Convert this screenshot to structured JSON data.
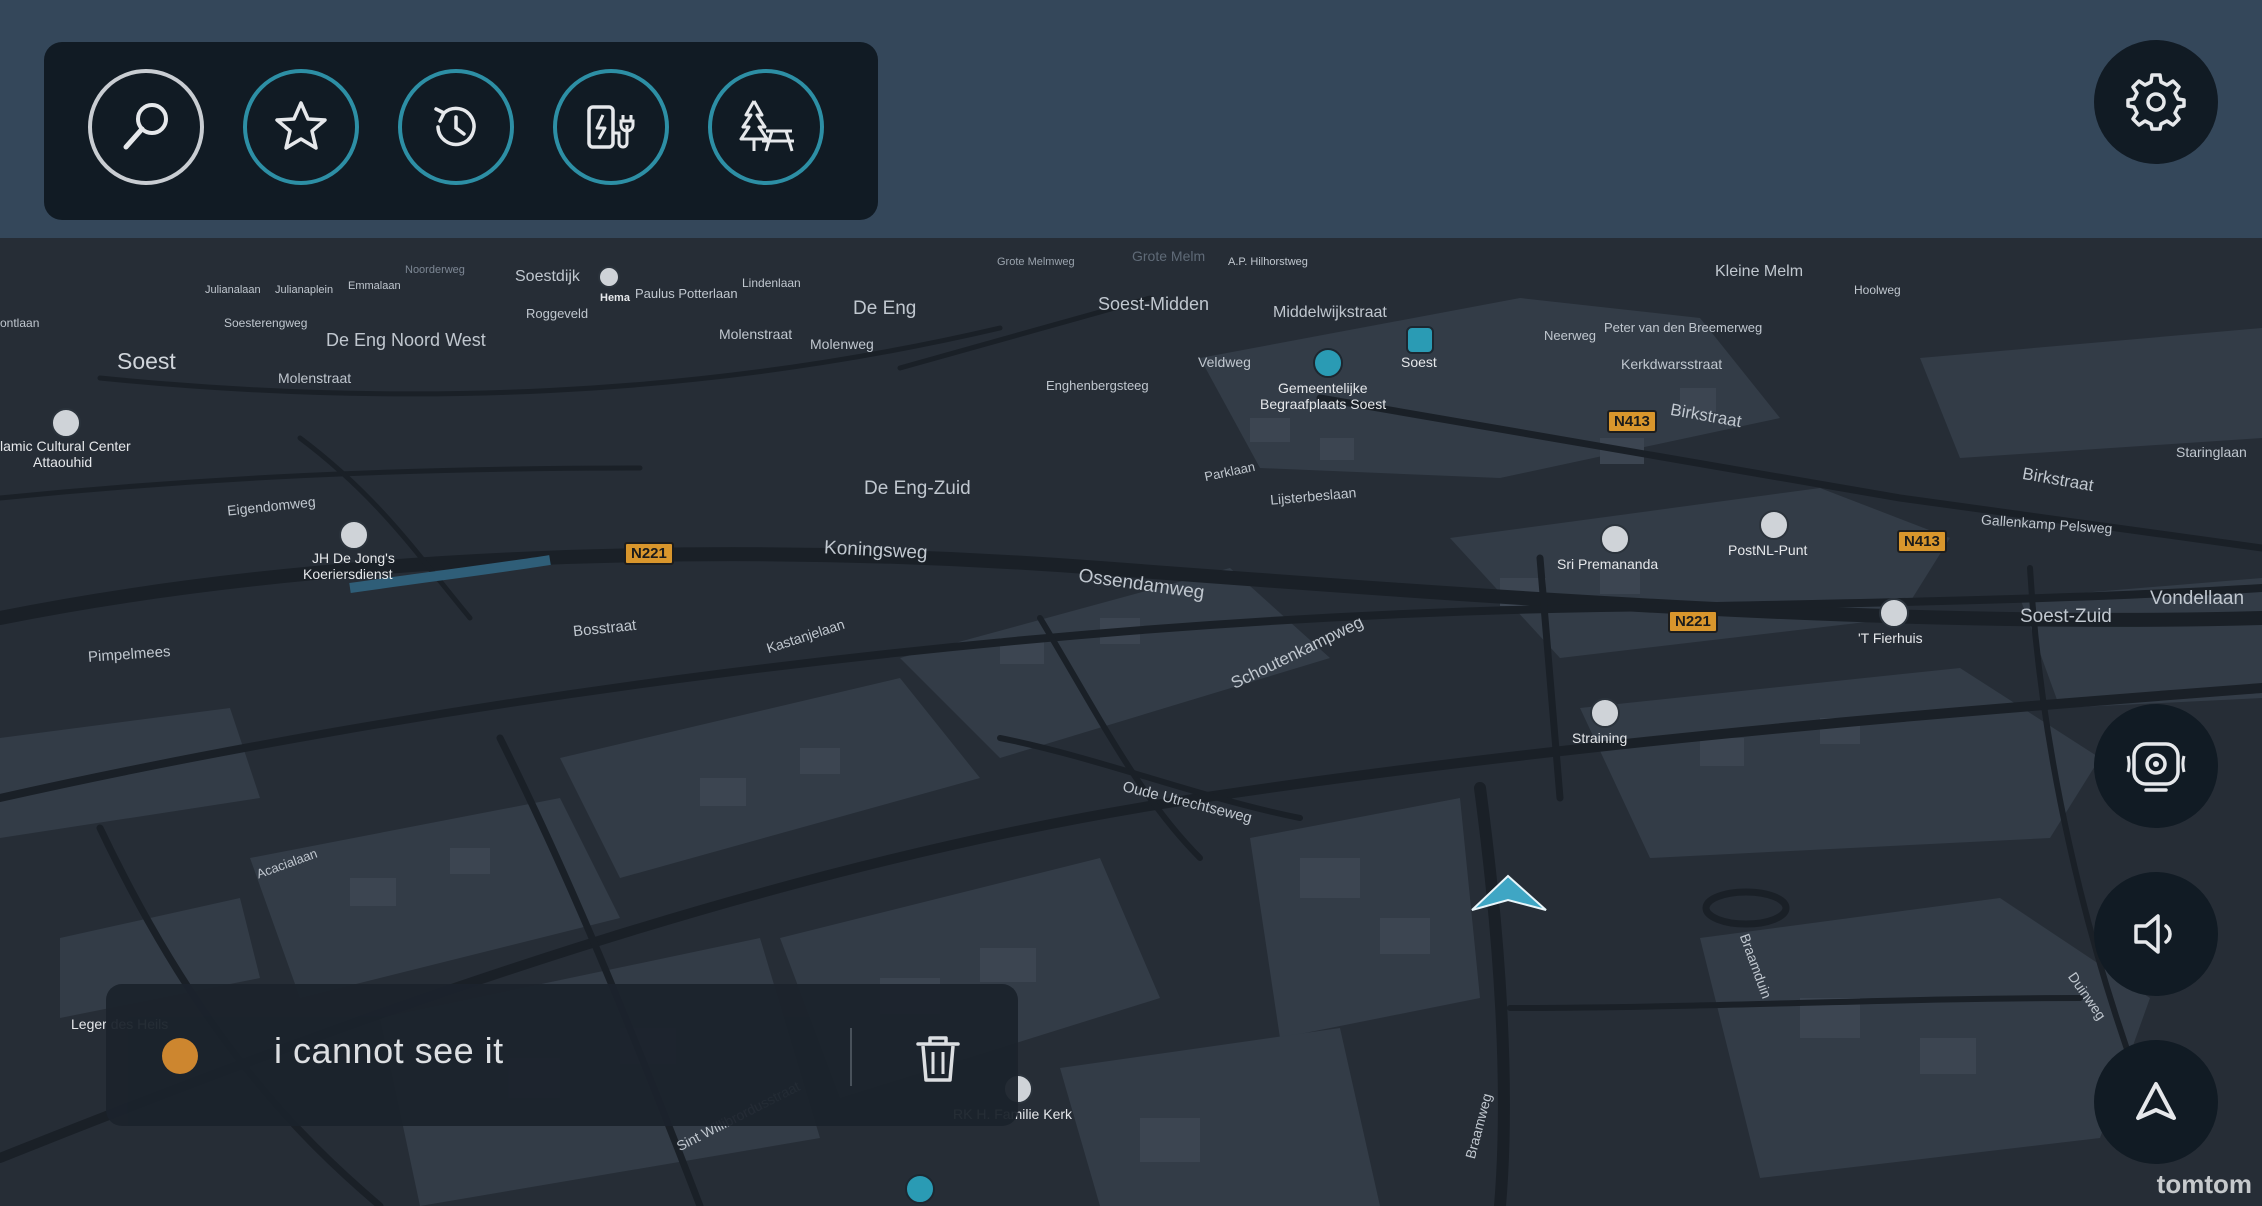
{
  "toolbar": {
    "buttons": [
      {
        "name": "search",
        "icon": "search-icon"
      },
      {
        "name": "favorites",
        "icon": "star-icon"
      },
      {
        "name": "recent",
        "icon": "history-icon"
      },
      {
        "name": "ev-charging",
        "icon": "ev-charger-icon"
      },
      {
        "name": "rest-area",
        "icon": "picnic-icon"
      }
    ]
  },
  "settings": {
    "icon": "gear-icon"
  },
  "side_controls": [
    {
      "name": "speed-camera",
      "icon": "camera-icon"
    },
    {
      "name": "volume",
      "icon": "speaker-icon"
    },
    {
      "name": "recenter",
      "icon": "arrow-up-icon"
    }
  ],
  "map": {
    "labels": {
      "soest": "Soest",
      "soestdijk": "Soestdijk",
      "hema": "Hema",
      "paulus_potterlaan": "Paulus Potterlaan",
      "lindenlaan": "Lindenlaan",
      "de_eng": "De Eng",
      "soest_midden": "Soest-Midden",
      "middelwijkstraat": "Middelwijkstraat",
      "soest_station": "Soest",
      "kleine_melm": "Kleine Melm",
      "hoolweg": "Hoolweg",
      "julianalaan": "Julianalaan",
      "julianaplein": "Julianaplein",
      "emmalaan": "Emmalaan",
      "noorderweg": "Noorderweg",
      "grote_melmweg": "Grote Melmweg",
      "grote_melm": "Grote Melm",
      "hilhorstweg": "A.P. Hilhorstweg",
      "ontlaan": "ontlaan",
      "soesterengweg": "Soesterengweg",
      "roggeveld": "Roggeveld",
      "de_eng_noord_west": "De Eng Noord West",
      "molenstraat_1": "Molenstraat",
      "molenstraat_2": "Molenstraat",
      "molenweg": "Molenweg",
      "veldweg": "Veldweg",
      "begraafplaats_1": "Gemeentelijke",
      "begraafplaats_2": "Begraafplaats Soest",
      "enghenbergsteeg": "Enghenbergsteeg",
      "neerweg": "Neerweg",
      "peter_van_den_breemerweg": "Peter van den Breemerweg",
      "kerkdwarsstraat": "Kerkdwarsstraat",
      "birkstraat_1": "Birkstraat",
      "birkstraat_2": "Birkstraat",
      "staringlaan": "Staringlaan",
      "cultural_center_1": "lamic Cultural Center",
      "cultural_center_2": "Attaouhid",
      "de_eng_zuid": "De Eng-Zuid",
      "parklaan": "Parklaan",
      "lijsterbeslaan": "Lijsterbeslaan",
      "eigendomweg": "Eigendomweg",
      "jh_de_jong_1": "JH De Jong's",
      "jh_de_jong_2": "Koeriersdienst",
      "koningsweg": "Koningsweg",
      "ossendamweg": "Ossendamweg",
      "sri_premananda": "Sri Premananda",
      "postnl_punt": "PostNL-Punt",
      "gallenkamp_pelsweg": "Gallenkamp Pelsweg",
      "vondellaan": "Vondellaan",
      "soest_zuid": "Soest-Zuid",
      "t_fierhuis": "'T Fierhuis",
      "bosstraat": "Bosstraat",
      "kastanjelaan": "Kastanjelaan",
      "schoutenkampweg": "Schoutenkampweg",
      "pimpelmees": "Pimpelmees",
      "straining": "Straining",
      "oude_utrechtseweg": "Oude Utrechtseweg",
      "acacialaan": "Acacialaan",
      "braamduin": "Braamduin",
      "duinweg": "Duinweg",
      "leger_des_heils": "Leger des Heils",
      "sint_willibrordusstraat": "Sint Willibrordusstraat",
      "rk_kerk": "RK H. Familie Kerk",
      "braamweg": "Braamweg"
    },
    "shields": {
      "n221_a": "N221",
      "n221_b": "N221",
      "n413_a": "N413",
      "n413_b": "N413"
    }
  },
  "note": {
    "text": "i cannot see it",
    "dot_color": "#d68b2f",
    "delete_icon": "trash-icon"
  },
  "brand": "tomtom",
  "colors": {
    "top_background": "#34475a",
    "map_background": "#262d36",
    "panel": "#111b24",
    "accent": "#2d8fa5"
  }
}
